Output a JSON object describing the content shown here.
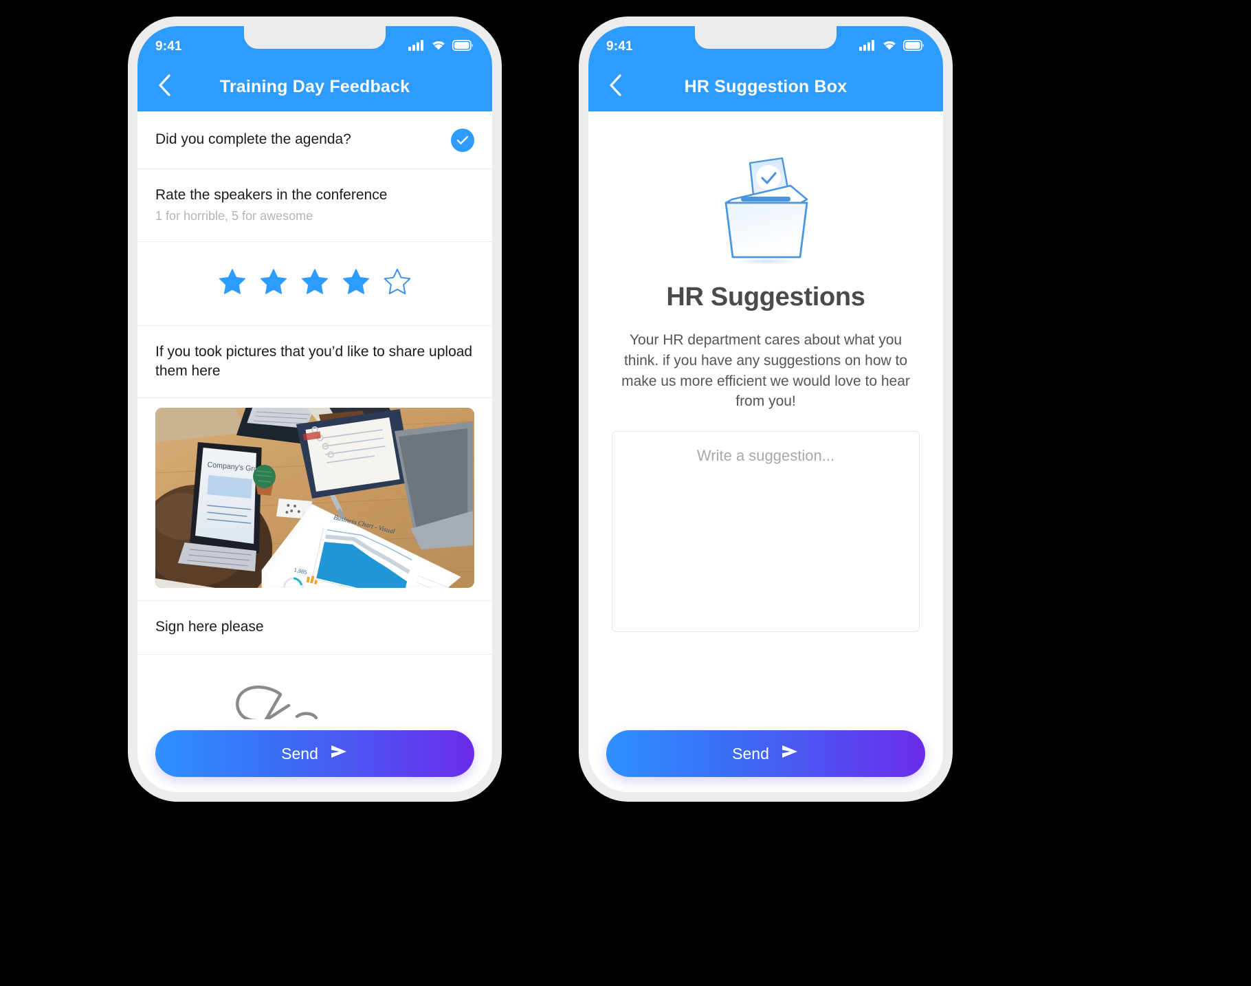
{
  "theme": {
    "accent_blue": "#2E9BFF",
    "frame_gray": "#ECECEC",
    "page_background": "#000000",
    "send_gradient_start": "#2E90FF",
    "send_gradient_end": "#6B2BE8",
    "muted_text": "#B4B4B4"
  },
  "phones": [
    {
      "status_bar": {
        "time": "9:41",
        "signal_icon": "cellular-signal-icon",
        "wifi_icon": "wifi-icon",
        "battery_icon": "battery-icon"
      },
      "nav": {
        "back_icon": "chevron-left-icon",
        "title": "Training Day Feedback"
      },
      "form": {
        "question_1": {
          "label": "Did you complete the agenda?",
          "checked": true,
          "check_icon": "checkmark-circle-icon"
        },
        "question_2": {
          "label": "Rate the speakers in the conference",
          "hint": "1 for horrible, 5 for awesome",
          "rating": 4,
          "max_rating": 5,
          "star_icon": "star-icon"
        },
        "question_3": {
          "label": "If you took pictures that you’d like to share upload them here",
          "photo_alt": "office-desk-meeting-photo"
        },
        "question_4": {
          "label": "Sign here please",
          "signature_present": true
        }
      },
      "send": {
        "label": "Send",
        "icon": "send-arrow-icon"
      }
    },
    {
      "status_bar": {
        "time": "9:41",
        "signal_icon": "cellular-signal-icon",
        "wifi_icon": "wifi-icon",
        "battery_icon": "battery-icon"
      },
      "nav": {
        "back_icon": "chevron-left-icon",
        "title": "HR Suggestion Box"
      },
      "content": {
        "illustration_icon": "ballot-box-icon",
        "heading": "HR Suggestions",
        "description": "Your HR department cares about what you think. if you have any suggestions on how to make us more efficient we would love to hear from you!",
        "suggestion_input": {
          "value": "",
          "placeholder": "Write a suggestion..."
        }
      },
      "send": {
        "label": "Send",
        "icon": "send-arrow-icon"
      }
    }
  ]
}
